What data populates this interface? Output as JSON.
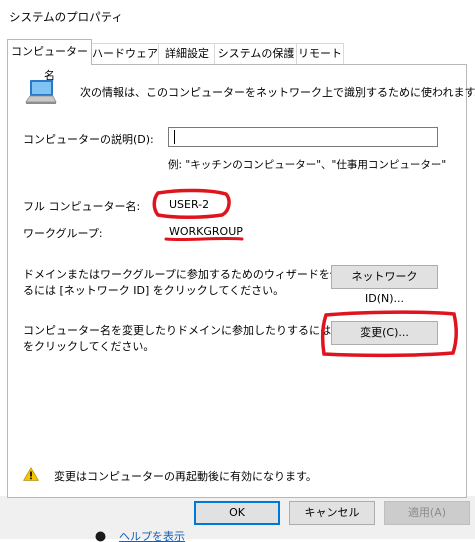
{
  "window": {
    "title": "システムのプロパティ"
  },
  "tabs": [
    {
      "label": "コンピューター名",
      "active": true
    },
    {
      "label": "ハードウェア",
      "active": false
    },
    {
      "label": "詳細設定",
      "active": false
    },
    {
      "label": "システムの保護",
      "active": false
    },
    {
      "label": "リモート",
      "active": false
    }
  ],
  "computer_name_tab": {
    "intro_text": "次の情報は、このコンピューターをネットワーク上で識別するために使われます。",
    "description_label": "コンピューターの説明(D):",
    "description_value": "",
    "description_example": "例: \"キッチンのコンピューター\"、\"仕事用コンピューター\"",
    "full_name_label": "フル コンピューター名:",
    "full_name_value": "USER-2",
    "workgroup_label": "ワークグループ:",
    "workgroup_value": "WORKGROUP",
    "network_id_text_line1": "ドメインまたはワークグループに参加するためのウィザードを使用す",
    "network_id_text_line2": "るには [ネットワーク ID] をクリックしてください。",
    "network_id_button": "ネットワーク ID(N)...",
    "change_text_line1": "コンピューター名を変更したりドメインに参加したりするには [変更]",
    "change_text_line2": "をクリックしてください。",
    "change_button": "変更(C)...",
    "warning_text": "変更はコンピューターの再起動後に有効になります。"
  },
  "footer": {
    "ok": "OK",
    "cancel": "キャンセル",
    "apply": "適用(A)"
  },
  "behind_window_text": "ヘルプを表示",
  "colors": {
    "annotation_red": "#e0141e",
    "default_button_border": "#0078d7",
    "warning_yellow": "#f5c400",
    "footer_bg": "#f0f0f0"
  },
  "icons": [
    "computer-icon",
    "warning-icon",
    "help-icon"
  ]
}
